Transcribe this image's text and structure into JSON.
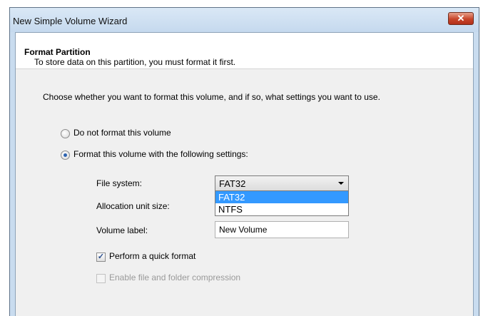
{
  "window": {
    "title": "New Simple Volume Wizard",
    "close_glyph": "✕"
  },
  "header": {
    "title": "Format Partition",
    "subtitle": "To store data on this partition, you must format it first."
  },
  "intro_text": "Choose whether you want to format this volume, and if so, what settings you want to use.",
  "options": {
    "do_not_format": {
      "label": "Do not format this volume",
      "selected": false
    },
    "format": {
      "label": "Format this volume with the following settings:",
      "selected": true
    }
  },
  "fields": {
    "file_system": {
      "label": "File system:",
      "value": "FAT32",
      "options": [
        "FAT32",
        "NTFS"
      ],
      "highlighted": "FAT32"
    },
    "allocation_unit_size": {
      "label": "Allocation unit size:"
    },
    "volume_label": {
      "label": "Volume label:",
      "value": "New Volume"
    }
  },
  "checkboxes": {
    "quick_format": {
      "label": "Perform a quick format",
      "checked": true,
      "enabled": true
    },
    "compression": {
      "label": "Enable file and folder compression",
      "checked": false,
      "enabled": false
    }
  },
  "colors": {
    "titlebar": "#c9dcef",
    "selection": "#3399ff",
    "close_button": "#c7452a"
  }
}
